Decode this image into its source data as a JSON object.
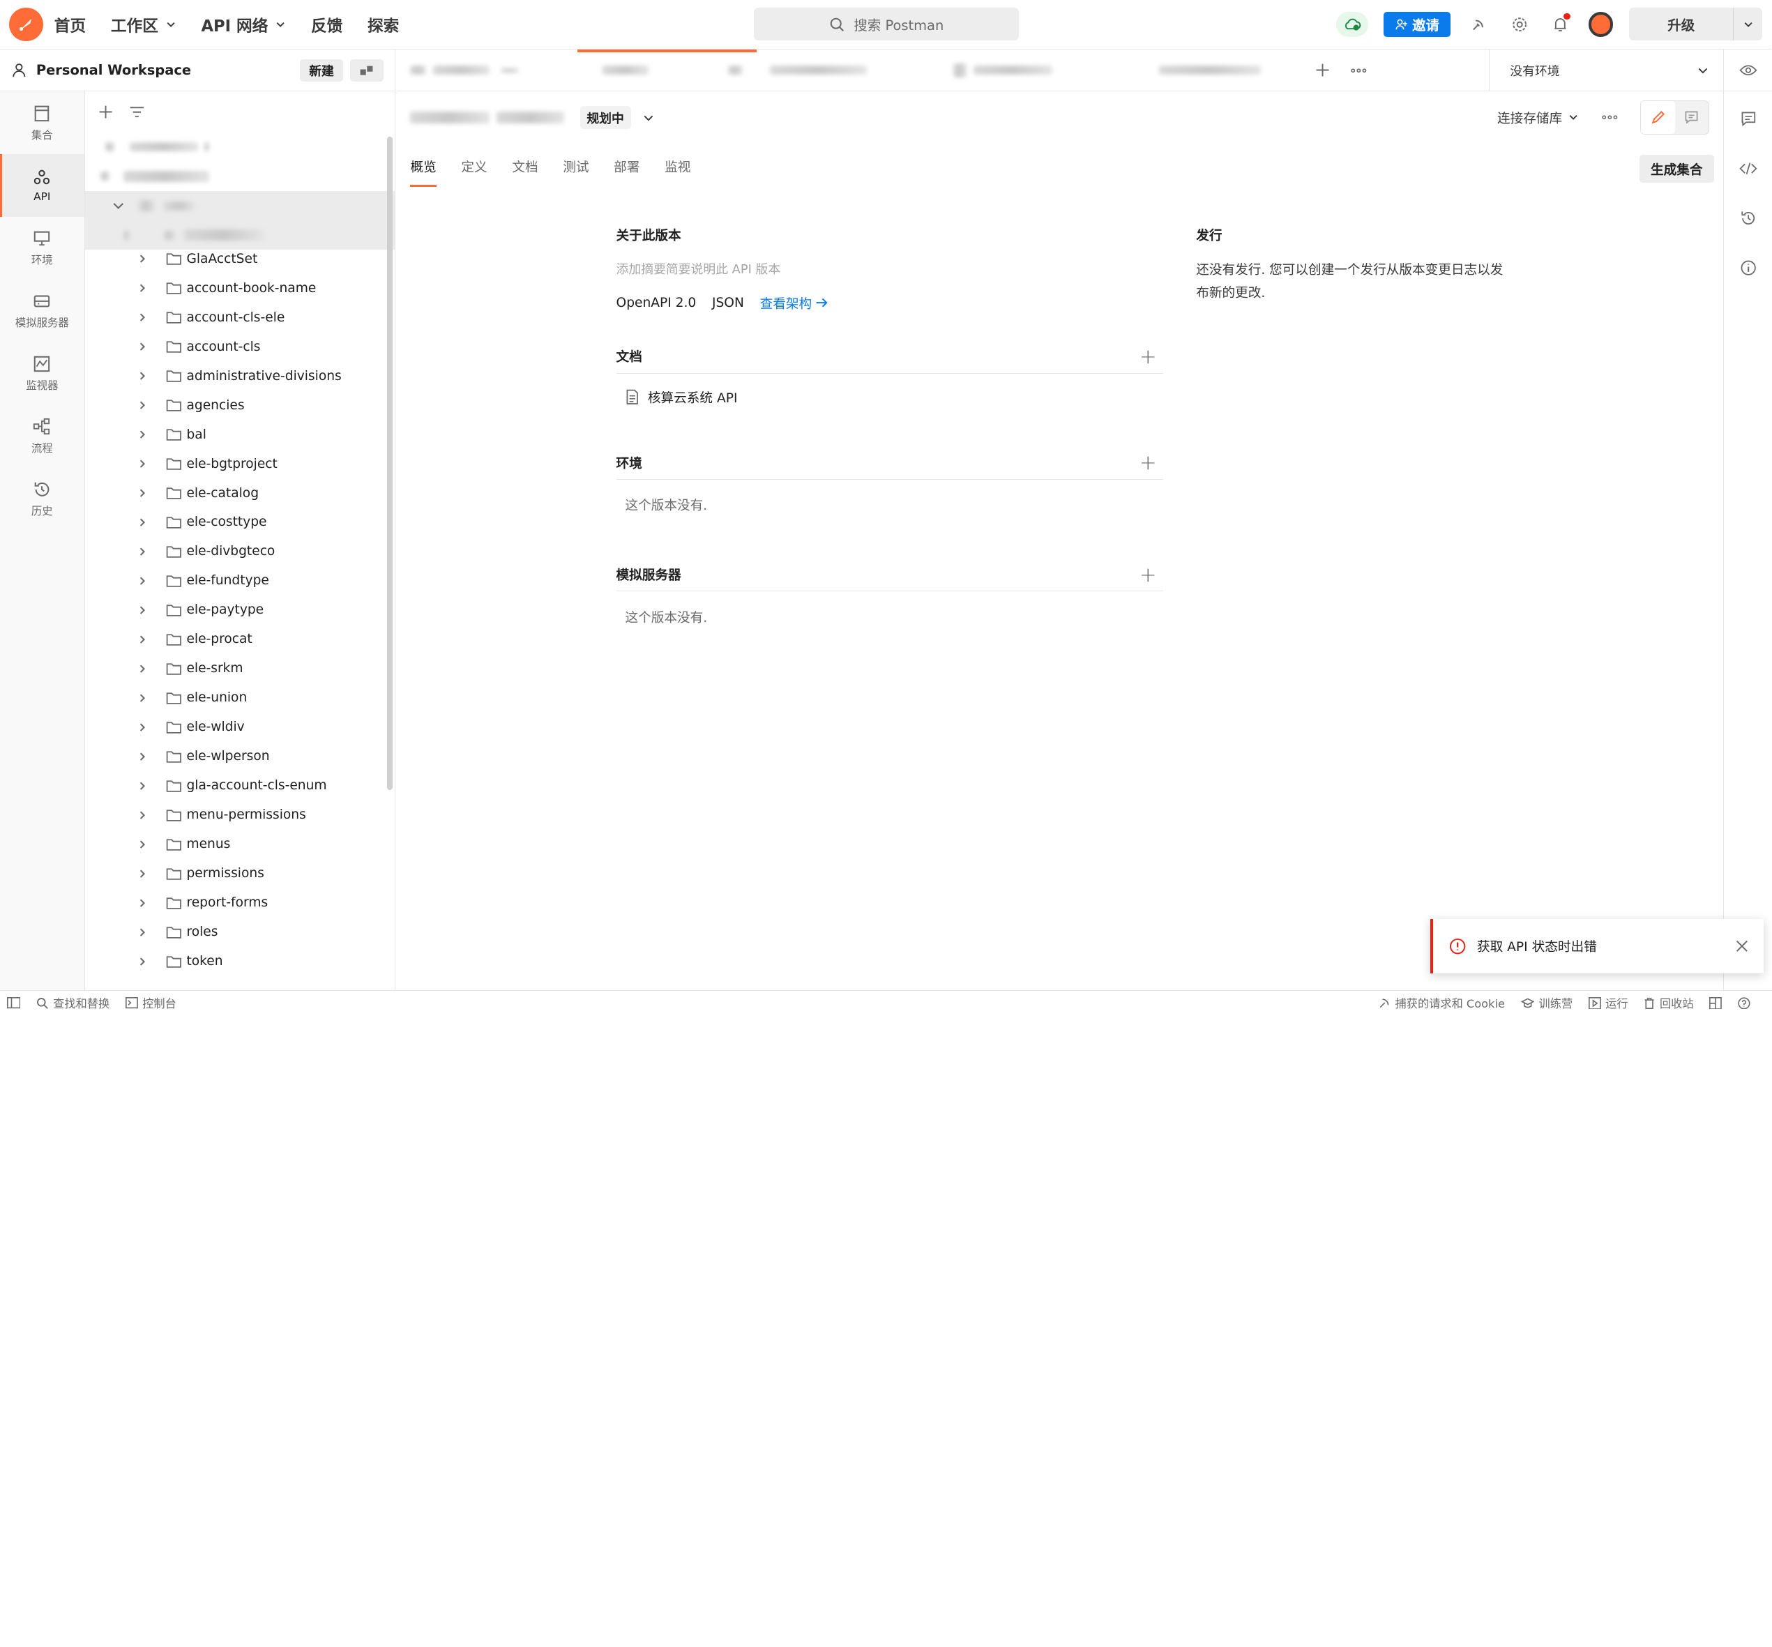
{
  "nav": {
    "home": "首页",
    "workspace": "工作区",
    "api_network": "API 网络",
    "feedback": "反馈",
    "explore": "探索"
  },
  "search": {
    "placeholder": "搜索 Postman"
  },
  "header_right": {
    "invite": "邀请",
    "upgrade": "升级"
  },
  "workspace": {
    "name": "Personal Workspace",
    "new_btn": "新建"
  },
  "rail": [
    {
      "label": "集合",
      "icon": "collections-icon"
    },
    {
      "label": "API",
      "icon": "api-icon"
    },
    {
      "label": "环境",
      "icon": "environments-icon"
    },
    {
      "label": "模拟服务器",
      "icon": "mock-server-icon"
    },
    {
      "label": "监视器",
      "icon": "monitor-icon"
    },
    {
      "label": "流程",
      "icon": "flows-icon"
    },
    {
      "label": "历史",
      "icon": "history-icon"
    }
  ],
  "tree": {
    "folders": [
      "GlaAcctSet",
      "account-book-name",
      "account-cls-ele",
      "account-cls",
      "administrative-divisions",
      "agencies",
      "bal",
      "ele-bgtproject",
      "ele-catalog",
      "ele-costtype",
      "ele-divbgteco",
      "ele-fundtype",
      "ele-paytype",
      "ele-procat",
      "ele-srkm",
      "ele-union",
      "ele-wldiv",
      "ele-wlperson",
      "gla-account-cls-enum",
      "menu-permissions",
      "menus",
      "permissions",
      "report-forms",
      "roles",
      "token"
    ]
  },
  "env": {
    "label": "没有环境"
  },
  "main": {
    "status": "规划中",
    "connect_repo": "连接存储库",
    "subtabs": [
      "概览",
      "定义",
      "文档",
      "测试",
      "部署",
      "监视"
    ],
    "generate": "生成集合",
    "about": {
      "title": "关于此版本",
      "placeholder": "添加摘要简要说明此 API 版本",
      "spec": "OpenAPI 2.0",
      "format": "JSON",
      "view_schema": "查看架构"
    },
    "docs": {
      "title": "文档",
      "item": "核算云系统 API"
    },
    "environments": {
      "title": "环境",
      "empty": "这个版本没有."
    },
    "mock": {
      "title": "模拟服务器",
      "empty": "这个版本没有."
    },
    "releases": {
      "title": "发行",
      "text": "还没有发行. 您可以创建一个发行从版本变更日志以发布新的更改."
    }
  },
  "statusbar": {
    "find_replace": "查找和替换",
    "console": "控制台",
    "capture": "捕获的请求和 Cookie",
    "bootcamp": "训练营",
    "runner": "运行",
    "trash": "回收站"
  },
  "toast": {
    "message": "获取 API 状态时出错"
  },
  "colors": {
    "accent": "#ff6c37",
    "primary": "#097bed",
    "error": "#eb2013"
  }
}
